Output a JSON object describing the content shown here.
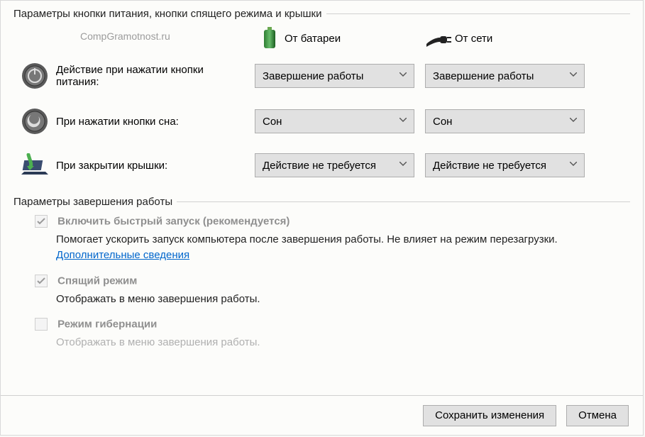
{
  "section1": {
    "title": "Параметры кнопки питания, кнопки спящего режима и крышки",
    "watermark": "CompGramotnost.ru",
    "col_battery": "От батареи",
    "col_ac": "От сети",
    "rows": [
      {
        "label": "Действие при нажатии кнопки питания:",
        "battery": "Завершение работы",
        "ac": "Завершение работы"
      },
      {
        "label": "При нажатии кнопки сна:",
        "battery": "Сон",
        "ac": "Сон"
      },
      {
        "label": "При закрытии крышки:",
        "battery": "Действие не требуется",
        "ac": "Действие не требуется"
      }
    ]
  },
  "section2": {
    "title": "Параметры завершения работы",
    "items": [
      {
        "checked": true,
        "disabled": true,
        "label": "Включить быстрый запуск (рекомендуется)",
        "sub": "Помогает ускорить запуск компьютера после завершения работы. Не влияет на режим перезагрузки.",
        "link": "Дополнительные сведения"
      },
      {
        "checked": true,
        "disabled": true,
        "label": "Спящий режим",
        "sub": "Отображать в меню завершения работы."
      },
      {
        "checked": false,
        "disabled": true,
        "label": "Режим гибернации",
        "sub_cut": "Отображать в меню завершения работы."
      }
    ]
  },
  "footer": {
    "save": "Сохранить изменения",
    "cancel": "Отмена"
  }
}
